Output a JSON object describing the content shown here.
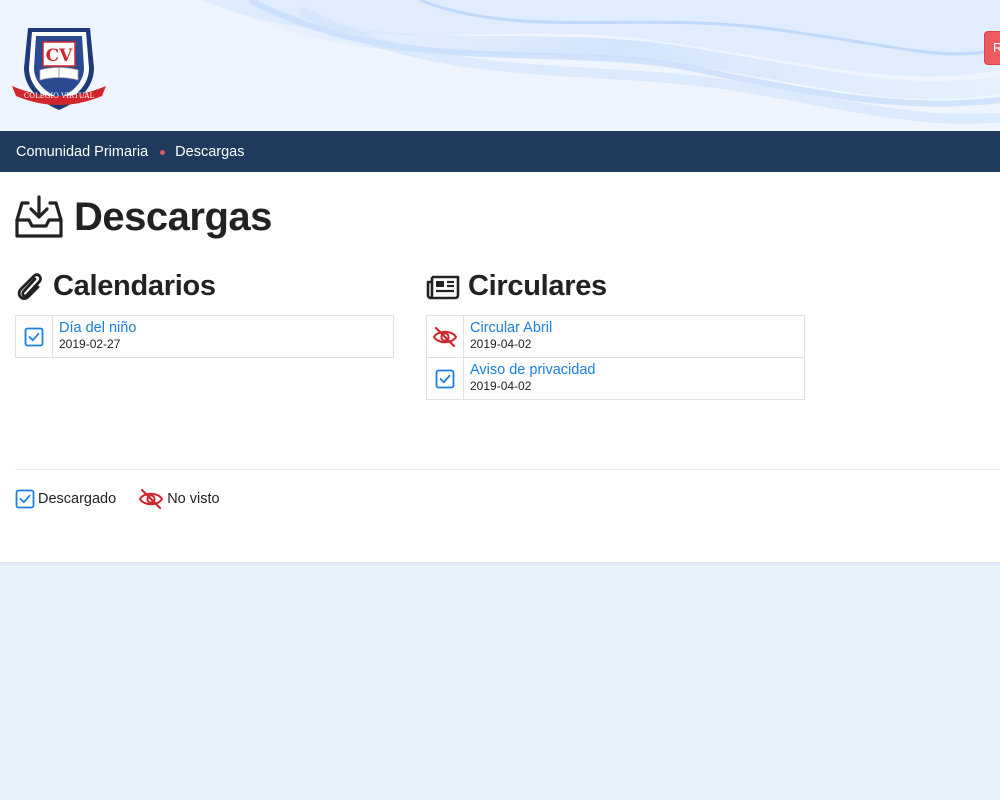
{
  "brand": {
    "logo_initials": "CV",
    "logo_ribbon": "COLEGIO VIRTUAL",
    "color_navy": "#1f3a5c",
    "color_red": "#d2262d",
    "color_link": "#1a7fe0"
  },
  "header": {
    "right_button_label": "R"
  },
  "breadcrumb": {
    "items": [
      {
        "label": "Comunidad Primaria"
      },
      {
        "label": "Descargas"
      }
    ]
  },
  "page": {
    "title": "Descargas",
    "icon": "download-tray-icon"
  },
  "sections": [
    {
      "title": "Calendarios",
      "icon": "paperclip-icon",
      "files": [
        {
          "name": "Día del niño",
          "date": "2019-02-27",
          "status": "downloaded"
        }
      ]
    },
    {
      "title": "Circulares",
      "icon": "newspaper-icon",
      "files": [
        {
          "name": "Circular Abril",
          "date": "2019-04-02",
          "status": "not-seen"
        },
        {
          "name": "Aviso de privacidad",
          "date": "2019-04-02",
          "status": "downloaded"
        }
      ]
    }
  ],
  "legend": {
    "downloaded_label": "Descargado",
    "not_seen_label": "No visto"
  }
}
